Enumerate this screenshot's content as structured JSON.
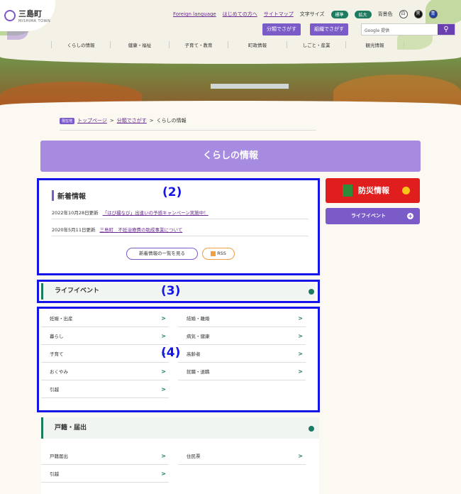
{
  "header": {
    "logo_name": "三島町",
    "logo_sub": "MISHIMA TOWN",
    "links": [
      "Foreign language",
      "はじめての方へ",
      "サイトマップ"
    ],
    "font_size_label": "文字サイズ",
    "font_size_options": [
      "標準",
      "拡大"
    ],
    "bg_color_label": "背景色",
    "bg_color_options": [
      "白",
      "黒",
      "青"
    ],
    "search_category_button": "分類でさがす",
    "search_org_button": "組織でさがす",
    "search_placeholder": "Google 提供"
  },
  "nav": [
    "くらしの情報",
    "健康・福祉",
    "子育て・教育",
    "町政情報",
    "しごと・産業",
    "観光情報"
  ],
  "breadcrumb": {
    "here_label": "現在地",
    "items": [
      "トップページ",
      "分類でさがす",
      "くらしの情報"
    ]
  },
  "page_title": "くらしの情報",
  "news": {
    "heading": "新着情報",
    "items": [
      {
        "date": "2022年10月28日更新",
        "title": "「はび撮なび」出逢いの予感キャンペーン実施中！"
      },
      {
        "date": "2020年5月11日更新",
        "title": "三島町　不妊治療費の助成事業について"
      }
    ],
    "list_button": "新着情報の一覧を見る",
    "rss_button": "RSS"
  },
  "annotations": [
    "(2)",
    "(3)",
    "(4)"
  ],
  "life_event": "ライフイベント",
  "categories": [
    "妊娠・出産",
    "結婚・離婚",
    "暮らし",
    "病気・健康",
    "子育て",
    "高齢者",
    "おくやみ",
    "就職・退職",
    "引越"
  ],
  "koseki": {
    "heading": "戸籍・届出",
    "items": [
      "戸籍届出",
      "住民票",
      "引越"
    ]
  },
  "side": {
    "disaster": "防災情報",
    "life_event": "ライフイベント"
  },
  "colors": {
    "purple": "#7a5bc7",
    "green": "#1d7b62",
    "annotation_blue": "#1515e8",
    "disaster_red": "#e01e1e"
  }
}
